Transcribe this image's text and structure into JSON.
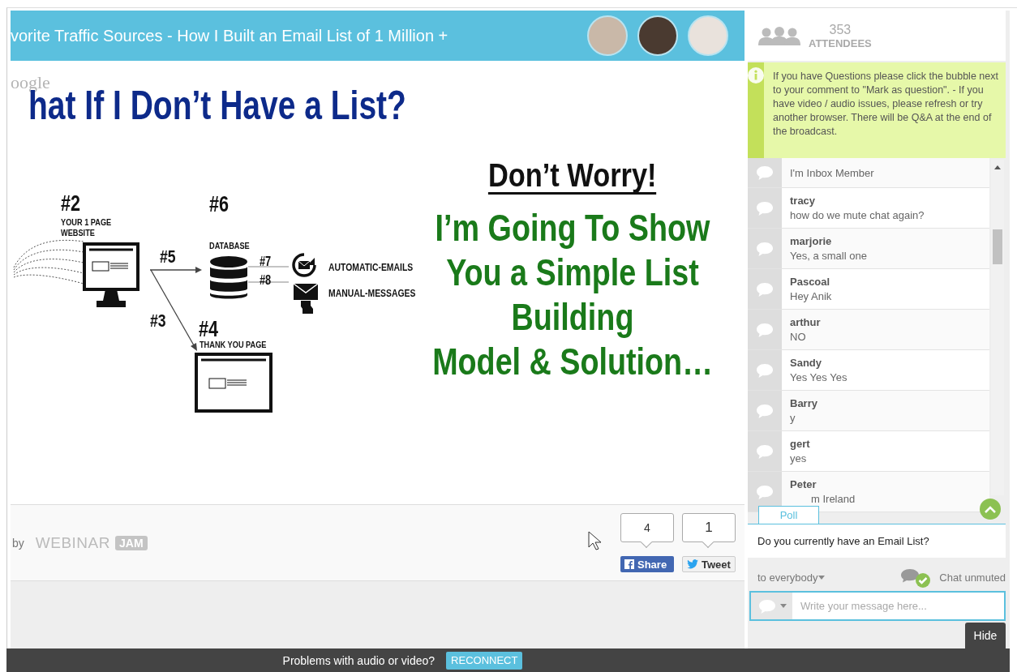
{
  "header": {
    "title": "vorite Traffic Sources - How I Built an Email List of 1 Million +"
  },
  "slide": {
    "logo_fragment": "oogle",
    "title": "hat If I Don’t Have a List?",
    "diagram_labels": [
      {
        "kind": "step",
        "text": "#2"
      },
      {
        "kind": "caption",
        "text": "YOUR 1 PAGE"
      },
      {
        "kind": "caption",
        "text": "WEBSITE"
      },
      {
        "kind": "step-medium",
        "text": "#5"
      },
      {
        "kind": "step",
        "text": "#6"
      },
      {
        "kind": "caption",
        "text": "DATABASE"
      },
      {
        "kind": "step-small",
        "text": "#7"
      },
      {
        "kind": "step-small",
        "text": "#8"
      },
      {
        "kind": "caption-wide",
        "text": "AUTOMATIC-EMAILS"
      },
      {
        "kind": "caption-wide",
        "text": "MANUAL-MESSAGES"
      },
      {
        "kind": "step-medium",
        "text": "#3"
      },
      {
        "kind": "step",
        "text": "#4"
      },
      {
        "kind": "caption",
        "text": "THANK YOU PAGE"
      }
    ],
    "headline": "Don’t Worry!",
    "body_lines": [
      "I’m Going To Show",
      "You a Simple List",
      "Building",
      "Model & Solution…"
    ]
  },
  "footer": {
    "by": "by",
    "brand": "WEBINAR",
    "brand_badge": "JAM",
    "share": {
      "count": "4",
      "label": "Share"
    },
    "tweet": {
      "count": "1",
      "label": "Tweet"
    }
  },
  "attendees": {
    "count": "353",
    "label": "ATTENDEES"
  },
  "notice": "If you have Questions please click the bubble next to your comment to \"Mark as question\". - If you have video / audio issues, please refresh or try another browser. There will be Q&A at the end of the broadcast.",
  "chat": [
    {
      "message": "I'm Inbox Member"
    },
    {
      "name": "tracy",
      "message": "how do we mute chat again?"
    },
    {
      "name": "marjorie",
      "message": "Yes, a small one"
    },
    {
      "name": "Pascoal",
      "message": "Hey Anik"
    },
    {
      "name": "arthur",
      "message": "NO"
    },
    {
      "name": "Sandy",
      "message": "Yes Yes Yes"
    },
    {
      "name": "Barry",
      "message": "y"
    },
    {
      "name": "gert",
      "message": "yes"
    },
    {
      "name": "Peter",
      "message": "m Ireland"
    }
  ],
  "poll": {
    "tab": "Poll",
    "question": "Do you currently have an Email List?"
  },
  "recipient": "to everybody",
  "chat_status": {
    "label": "Chat unmuted",
    "muted": false
  },
  "message_input": {
    "placeholder": "Write your message here..."
  },
  "hide_button": "Hide",
  "connection_bar": {
    "message": "Problems with audio or video?",
    "button": "RECONNECT"
  }
}
